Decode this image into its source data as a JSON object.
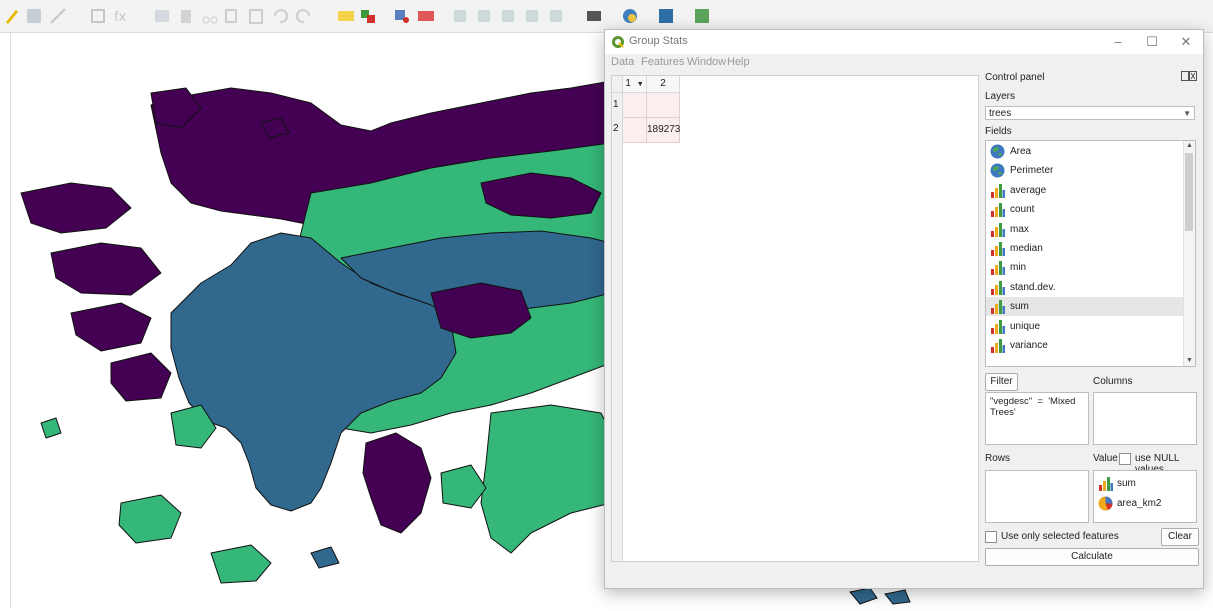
{
  "window": {
    "title": "Group Stats",
    "minimize_icon": "minimize-icon",
    "maximize_icon": "maximize-icon",
    "close_icon": "close-icon"
  },
  "menu": [
    "Data",
    "Features",
    "Window",
    "Help"
  ],
  "results_table": {
    "columns": [
      "1",
      "2"
    ],
    "rows": [
      {
        "header": "1",
        "cells": [
          "",
          ""
        ]
      },
      {
        "header": "2",
        "cells": [
          "",
          "189273"
        ]
      }
    ]
  },
  "control_panel": {
    "title": "Control panel",
    "layers_label": "Layers",
    "layer_selected": "trees",
    "fields_label": "Fields",
    "fields": [
      {
        "name": "Area",
        "icon": "globe-icon"
      },
      {
        "name": "Perimeter",
        "icon": "globe-icon"
      },
      {
        "name": "average",
        "icon": "bar-chart-icon"
      },
      {
        "name": "count",
        "icon": "bar-chart-icon"
      },
      {
        "name": "max",
        "icon": "bar-chart-icon"
      },
      {
        "name": "median",
        "icon": "bar-chart-icon"
      },
      {
        "name": "min",
        "icon": "bar-chart-icon"
      },
      {
        "name": "stand.dev.",
        "icon": "bar-chart-icon"
      },
      {
        "name": "sum",
        "icon": "bar-chart-icon"
      },
      {
        "name": "unique",
        "icon": "bar-chart-icon"
      },
      {
        "name": "variance",
        "icon": "bar-chart-icon"
      }
    ],
    "selected_field": "sum",
    "filter_button": "Filter",
    "columns_label": "Columns",
    "filter_expression": "\"vegdesc\"  =  'Mixed\nTrees'",
    "rows_label": "Rows",
    "value_label": "Value",
    "null_values_label": "use NULL values",
    "value_items": [
      {
        "name": "sum",
        "icon": "bar-chart-icon"
      },
      {
        "name": "area_km2",
        "icon": "pie-chart-icon"
      }
    ],
    "selected_only_label": "Use only selected features",
    "clear_button": "Clear",
    "calculate_button": "Calculate"
  },
  "colors": {
    "purple": "#440154",
    "blue": "#31688e",
    "green": "#35b779",
    "selection": "#e6e6e6",
    "cell": "#fbeeee"
  }
}
